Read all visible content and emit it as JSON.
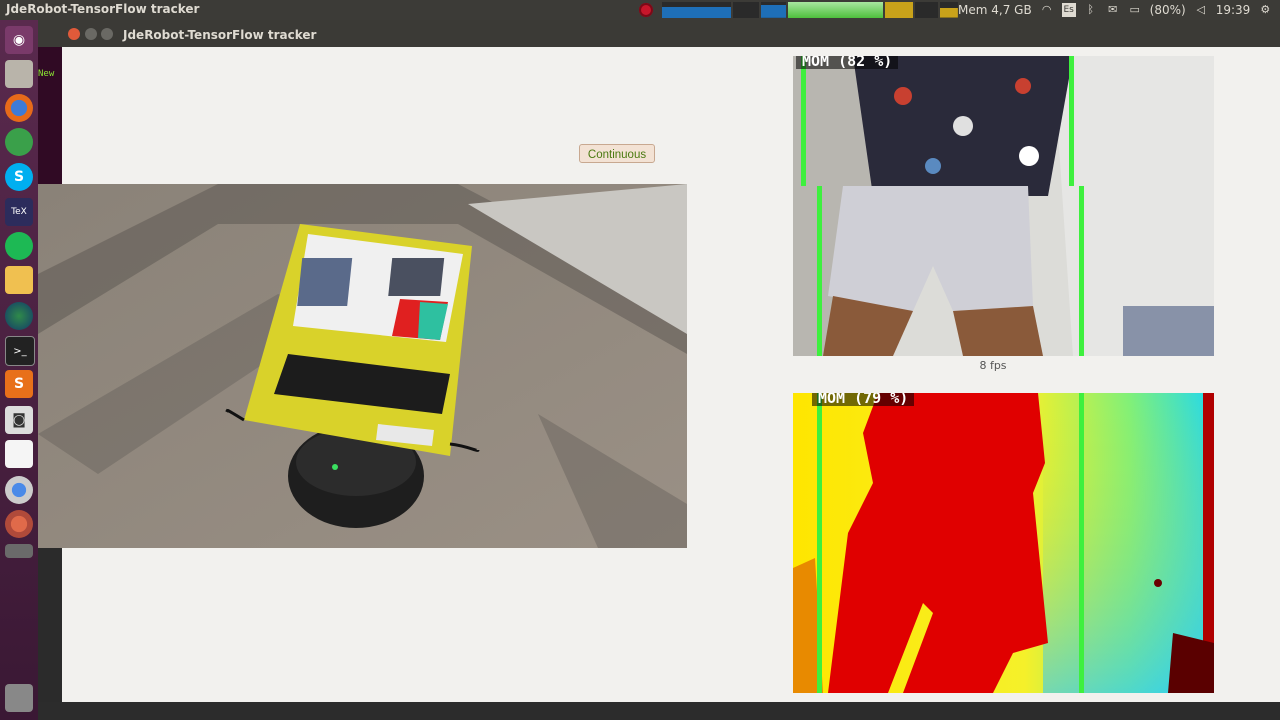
{
  "panel": {
    "app_title": "JdeRobot-TensorFlow tracker",
    "mem_label": "Mem 4,7 GB",
    "keyboard_label": "Es",
    "battery_label": "(80%)",
    "clock": "19:39",
    "colors": {
      "panel_bg": "#3c3b37",
      "record": "#c7162b"
    }
  },
  "launcher": {
    "items": [
      "dash-icon",
      "files-icon",
      "firefox-icon",
      "terminal-green-icon",
      "skype-icon",
      "tex-icon",
      "spotify-icon",
      "notes-icon",
      "globe-icon",
      "terminal-icon",
      "sublime-icon",
      "camera-icon",
      "document-icon",
      "chromium-icon",
      "app-icon",
      "usb-icon",
      "trash-icon"
    ]
  },
  "window": {
    "title": "JdeRobot-TensorFlow tracker",
    "bg_terminal_text": "New"
  },
  "controls": {
    "mode_button": "Continuous"
  },
  "views": {
    "rgb_detection_label": "MOM (82 %)",
    "depth_detection_label": "MOM (79 %)",
    "fps_label": "8 fps"
  }
}
